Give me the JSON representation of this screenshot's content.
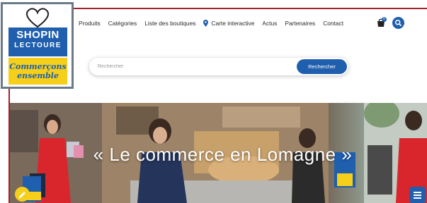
{
  "logo": {
    "line1": "SHOPIN",
    "line2": "LECTOURE",
    "tagline1": "Commerçons",
    "tagline2": "ensemble"
  },
  "nav": {
    "items": [
      {
        "label": "Produits"
      },
      {
        "label": "Catégories"
      },
      {
        "label": "Liste des boutiques"
      },
      {
        "label": "Carte interactive",
        "icon": "map-pin-icon"
      },
      {
        "label": "Actus"
      },
      {
        "label": "Partenaires"
      },
      {
        "label": "Contact"
      }
    ],
    "cart_icon": "shopping-bag-icon",
    "cart_count": "0",
    "search_icon": "search-icon"
  },
  "search": {
    "placeholder": "Rechercher",
    "button_label": "Rechercher"
  },
  "hero": {
    "title": "« Le commerce en Lomagne »"
  },
  "colors": {
    "brand_blue": "#1f5fae",
    "brand_yellow": "#f5cf1a",
    "accent_red": "#a5202a"
  },
  "floating": {
    "menu_icon": "hamburger-menu-icon",
    "left_badge_icon": "edit-icon"
  }
}
